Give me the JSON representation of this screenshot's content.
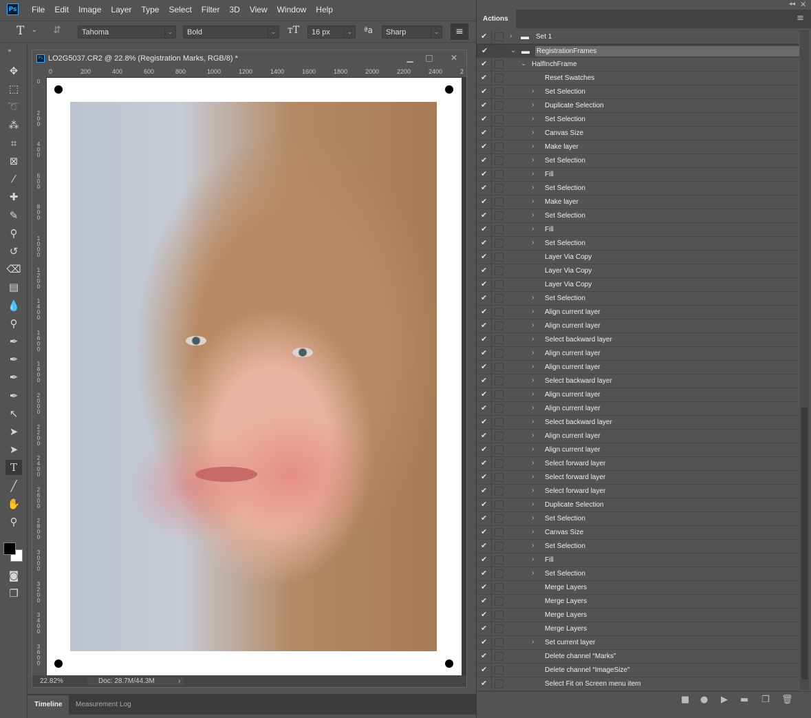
{
  "app": {
    "logo": "Ps",
    "menu": [
      "File",
      "Edit",
      "Image",
      "Layer",
      "Type",
      "Select",
      "Filter",
      "3D",
      "View",
      "Window",
      "Help"
    ]
  },
  "options": {
    "font_family": "Tahoma",
    "font_style": "Bold",
    "font_size": "16 px",
    "antialias": "Sharp",
    "tool_icon": "T"
  },
  "document": {
    "title": "LO2G5037.CR2 @ 22.8% (Registration Marks, RGB/8) *",
    "h_ruler": [
      "0",
      "200",
      "400",
      "600",
      "800",
      "1000",
      "1200",
      "1400",
      "1600",
      "1800",
      "2000",
      "2200",
      "2400",
      "2"
    ],
    "v_ruler": [
      "0",
      "200",
      "400",
      "600",
      "800",
      "1000",
      "1200",
      "1400",
      "1600",
      "1800",
      "2000",
      "2200",
      "2400",
      "2600",
      "2800",
      "3000",
      "3200",
      "3400",
      "3600"
    ],
    "zoom": "22.82%",
    "doc_size": "Doc: 28.7M/44.3M"
  },
  "bottom_tabs": [
    "Timeline",
    "Measurement Log"
  ],
  "actions": {
    "tab": "Actions",
    "rows": [
      {
        "label": "Set 1",
        "level": 0,
        "type": "set",
        "expand": "collapsed"
      },
      {
        "label": "RegistrationFrames",
        "level": 0,
        "type": "set",
        "expand": "expanded",
        "selected": true
      },
      {
        "label": "HalfInchFrame",
        "level": 1,
        "type": "action",
        "expand": "expanded"
      },
      {
        "label": "Reset Swatches",
        "level": 2
      },
      {
        "label": "Set Selection",
        "level": 2,
        "expand": "collapsed"
      },
      {
        "label": "Duplicate Selection",
        "level": 2,
        "expand": "collapsed"
      },
      {
        "label": "Set Selection",
        "level": 2,
        "expand": "collapsed"
      },
      {
        "label": "Canvas Size",
        "level": 2,
        "expand": "collapsed"
      },
      {
        "label": "Make layer",
        "level": 2,
        "expand": "collapsed"
      },
      {
        "label": "Set Selection",
        "level": 2,
        "expand": "collapsed"
      },
      {
        "label": "Fill",
        "level": 2,
        "expand": "collapsed"
      },
      {
        "label": "Set Selection",
        "level": 2,
        "expand": "collapsed"
      },
      {
        "label": "Make layer",
        "level": 2,
        "expand": "collapsed"
      },
      {
        "label": "Set Selection",
        "level": 2,
        "expand": "collapsed"
      },
      {
        "label": "Fill",
        "level": 2,
        "expand": "collapsed"
      },
      {
        "label": "Set Selection",
        "level": 2,
        "expand": "collapsed"
      },
      {
        "label": "Layer Via Copy",
        "level": 2
      },
      {
        "label": "Layer Via Copy",
        "level": 2
      },
      {
        "label": "Layer Via Copy",
        "level": 2
      },
      {
        "label": "Set Selection",
        "level": 2,
        "expand": "collapsed"
      },
      {
        "label": "Align current layer",
        "level": 2,
        "expand": "collapsed"
      },
      {
        "label": "Align current layer",
        "level": 2,
        "expand": "collapsed"
      },
      {
        "label": "Select backward layer",
        "level": 2,
        "expand": "collapsed"
      },
      {
        "label": "Align current layer",
        "level": 2,
        "expand": "collapsed"
      },
      {
        "label": "Align current layer",
        "level": 2,
        "expand": "collapsed"
      },
      {
        "label": "Select backward layer",
        "level": 2,
        "expand": "collapsed"
      },
      {
        "label": "Align current layer",
        "level": 2,
        "expand": "collapsed"
      },
      {
        "label": "Align current layer",
        "level": 2,
        "expand": "collapsed"
      },
      {
        "label": "Select backward layer",
        "level": 2,
        "expand": "collapsed"
      },
      {
        "label": "Align current layer",
        "level": 2,
        "expand": "collapsed"
      },
      {
        "label": "Align current layer",
        "level": 2,
        "expand": "collapsed"
      },
      {
        "label": "Select forward layer",
        "level": 2,
        "expand": "collapsed"
      },
      {
        "label": "Select forward layer",
        "level": 2,
        "expand": "collapsed"
      },
      {
        "label": "Select forward layer",
        "level": 2,
        "expand": "collapsed"
      },
      {
        "label": "Duplicate Selection",
        "level": 2,
        "expand": "collapsed"
      },
      {
        "label": "Set Selection",
        "level": 2,
        "expand": "collapsed"
      },
      {
        "label": "Canvas Size",
        "level": 2,
        "expand": "collapsed"
      },
      {
        "label": "Set Selection",
        "level": 2,
        "expand": "collapsed"
      },
      {
        "label": "Fill",
        "level": 2,
        "expand": "collapsed"
      },
      {
        "label": "Set Selection",
        "level": 2,
        "expand": "collapsed"
      },
      {
        "label": "Merge Layers",
        "level": 2
      },
      {
        "label": "Merge Layers",
        "level": 2
      },
      {
        "label": "Merge Layers",
        "level": 2
      },
      {
        "label": "Merge Layers",
        "level": 2
      },
      {
        "label": "Set current layer",
        "level": 2,
        "expand": "collapsed"
      },
      {
        "label": "Delete channel “Marks”",
        "level": 2
      },
      {
        "label": "Delete channel “ImageSize”",
        "level": 2
      },
      {
        "label": "Select Fit on Screen menu item",
        "level": 2
      }
    ]
  },
  "colors": {
    "panel": "#535353",
    "accent": "#31a8ff",
    "selected_row": "#6a6a6a"
  }
}
